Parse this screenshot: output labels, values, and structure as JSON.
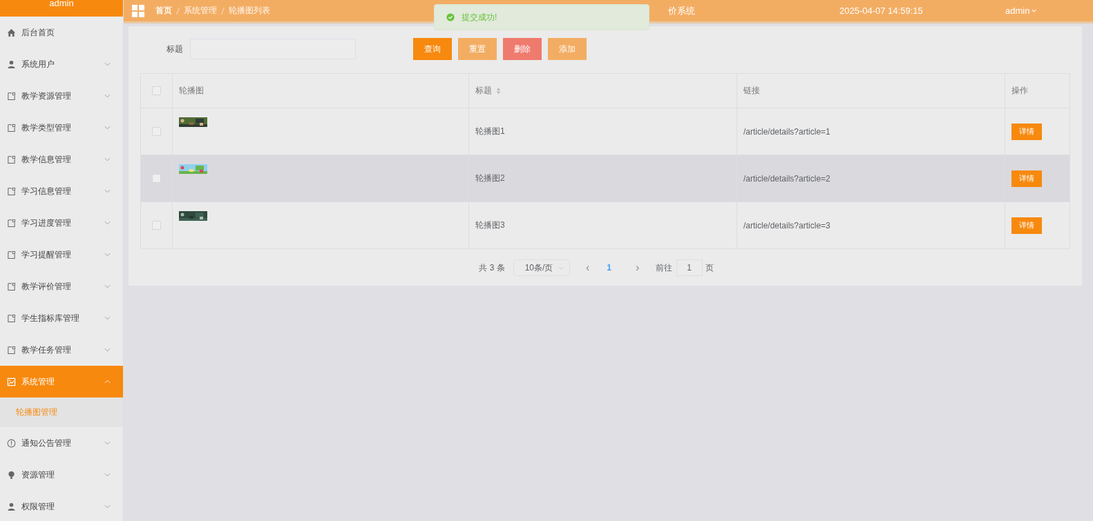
{
  "sidebar": {
    "header": "admin",
    "items": [
      {
        "label": "后台首页",
        "kind": "link",
        "selected": false
      },
      {
        "label": "系统用户",
        "kind": "menu",
        "expanded": false,
        "selected": false
      },
      {
        "label": "教学资源管理",
        "kind": "menu",
        "expanded": false,
        "selected": false
      },
      {
        "label": "教学类型管理",
        "kind": "menu",
        "expanded": false,
        "selected": false
      },
      {
        "label": "教学信息管理",
        "kind": "menu",
        "expanded": false,
        "selected": false
      },
      {
        "label": "学习信息管理",
        "kind": "menu",
        "expanded": false,
        "selected": false
      },
      {
        "label": "学习进度管理",
        "kind": "menu",
        "expanded": false,
        "selected": false
      },
      {
        "label": "学习提醒管理",
        "kind": "menu",
        "expanded": false,
        "selected": false
      },
      {
        "label": "教学评价管理",
        "kind": "menu",
        "expanded": false,
        "selected": false
      },
      {
        "label": "学生指标库管理",
        "kind": "menu",
        "expanded": false,
        "selected": false
      },
      {
        "label": "教学任务管理",
        "kind": "menu",
        "expanded": false,
        "selected": false
      },
      {
        "label": "系统管理",
        "kind": "menu",
        "expanded": true,
        "selected": true,
        "children": [
          {
            "label": "轮播图管理",
            "selected": true
          }
        ]
      },
      {
        "label": "通知公告管理",
        "kind": "menu",
        "expanded": false,
        "selected": false
      },
      {
        "label": "资源管理",
        "kind": "menu",
        "expanded": false,
        "selected": false
      },
      {
        "label": "权限管理",
        "kind": "menu",
        "expanded": false,
        "selected": false
      }
    ]
  },
  "topbar": {
    "breadcrumbs": [
      "首页",
      "系统管理",
      "轮播图列表"
    ],
    "title": "价系统",
    "datetime": "2025-04-07 14:59:15",
    "user": "admin"
  },
  "toast": {
    "kind": "success",
    "message": "提交成功!"
  },
  "search": {
    "label": "标题",
    "buttons": [
      {
        "label": "查询",
        "kind": "primary"
      },
      {
        "label": "重置",
        "kind": "light"
      },
      {
        "label": "删除",
        "kind": "danger"
      },
      {
        "label": "添加",
        "kind": "light"
      }
    ]
  },
  "table": {
    "header_checked": false,
    "columns": [
      {
        "label": "轮播图",
        "sortable": false
      },
      {
        "label": "标题",
        "sortable": true
      },
      {
        "label": "链接",
        "sortable": false
      },
      {
        "label": "操作",
        "sortable": false
      }
    ],
    "rows": [
      {
        "checked": false,
        "highlighted": false,
        "title": "轮播图1",
        "link": "/article/details?article=1",
        "action": "详情"
      },
      {
        "checked": false,
        "highlighted": true,
        "title": "轮播图2",
        "link": "/article/details?article=2",
        "action": "详情"
      },
      {
        "checked": false,
        "highlighted": false,
        "title": "轮播图3",
        "link": "/article/details?article=3",
        "action": "详情"
      }
    ]
  },
  "pagination": {
    "total": "共 3 条",
    "page_size": "10条/页",
    "prev": "‹",
    "pages": [
      {
        "label": "1",
        "selected": true
      }
    ],
    "next": "›",
    "goto_label": "前往",
    "goto_value": "1",
    "goto_suffix": "页"
  }
}
